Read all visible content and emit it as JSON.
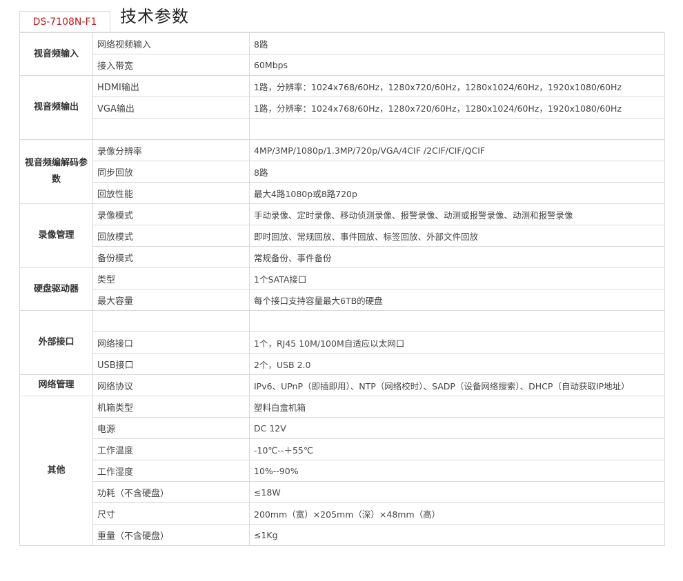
{
  "header": {
    "model": "DS-7108N-F1",
    "title": "技术参数"
  },
  "groups": [
    {
      "category": "视音频输入",
      "rows": [
        {
          "name": "网络视频输入",
          "value": "8路"
        },
        {
          "name": "接入带宽",
          "value": "60Mbps"
        }
      ]
    },
    {
      "category": "视音频输出",
      "rows": [
        {
          "name": "HDMI输出",
          "value": "1路，分辨率：1024x768/60Hz，1280x720/60Hz，1280x1024/60Hz，1920x1080/60Hz"
        },
        {
          "name": "VGA输出",
          "value": "1路，分辨率：1024x768/60Hz，1280x720/60Hz，1280x1024/60Hz，1920x1080/60Hz"
        },
        {
          "name": "",
          "value": ""
        }
      ]
    },
    {
      "category": "视音频编解码参数",
      "rows": [
        {
          "name": "录像分辨率",
          "value": "4MP/3MP/1080p/1.3MP/720p/VGA/4CIF /2CIF/CIF/QCIF"
        },
        {
          "name": "同步回放",
          "value": "8路"
        },
        {
          "name": "回放性能",
          "value": "最大4路1080p或8路720p"
        }
      ]
    },
    {
      "category": "录像管理",
      "rows": [
        {
          "name": "录像模式",
          "value": "手动录像、定时录像、移动侦测录像、报警录像、动测或报警录像、动测和报警录像"
        },
        {
          "name": "回放模式",
          "value": "即时回放、常规回放、事件回放、标签回放、外部文件回放"
        },
        {
          "name": "备份模式",
          "value": "常规备份、事件备份"
        }
      ]
    },
    {
      "category": "硬盘驱动器",
      "rows": [
        {
          "name": "类型",
          "value": "1个SATA接口"
        },
        {
          "name": "最大容量",
          "value": "每个接口支持容量最大6TB的硬盘"
        }
      ]
    },
    {
      "category": "外部接口",
      "rows": [
        {
          "name": "",
          "value": ""
        },
        {
          "name": "网络接口",
          "value": "1个，RJ45 10M/100M自适应以太网口"
        },
        {
          "name": "USB接口",
          "value": "2个，USB 2.0"
        }
      ]
    },
    {
      "category": "网络管理",
      "rows": [
        {
          "name": "网络协议",
          "value": "IPv6、UPnP（即插即用）、NTP（网络校时）、SADP（设备网络搜索）、DHCP（自动获取IP地址）"
        }
      ]
    },
    {
      "category": "其他",
      "rows": [
        {
          "name": "机箱类型",
          "value": "塑料白盒机箱"
        },
        {
          "name": "电源",
          "value": "DC 12V"
        },
        {
          "name": "工作温度",
          "value": "-10℃--＋55℃"
        },
        {
          "name": "工作湿度",
          "value": "10%--90%"
        },
        {
          "name": "功耗（不含硬盘）",
          "value": "≤18W"
        },
        {
          "name": "尺寸",
          "value": "200mm（宽）×205mm（深）×48mm（高）"
        },
        {
          "name": "重量（不含硬盘）",
          "value": "≤1Kg"
        }
      ]
    }
  ]
}
